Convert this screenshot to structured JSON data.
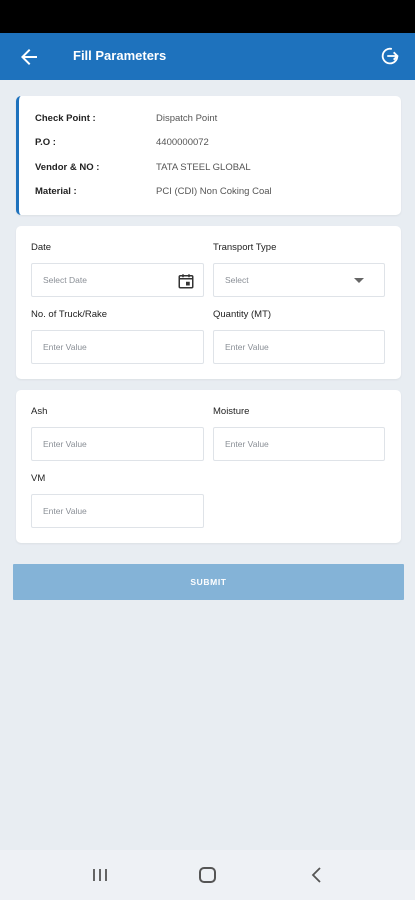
{
  "header": {
    "title": "Fill Parameters",
    "back_icon": "arrow-left-icon",
    "logout_icon": "logout-icon",
    "color": "#1e72bd"
  },
  "info": {
    "rows": [
      {
        "key": "Check Point :",
        "value": "Dispatch Point"
      },
      {
        "key": "P.O :",
        "value": "4400000072"
      },
      {
        "key": "Vendor & NO :",
        "value": "TATA STEEL GLOBAL"
      },
      {
        "key": "Material :",
        "value": "PCI (CDI) Non Coking Coal"
      }
    ]
  },
  "form": {
    "date": {
      "label": "Date",
      "placeholder": "Select Date",
      "icon": "calendar-icon"
    },
    "transport_type": {
      "label": "Transport Type",
      "selected": "Select"
    },
    "trucks": {
      "label": "No. of Truck/Rake",
      "placeholder": "Enter Value"
    },
    "quantity": {
      "label": "Quantity (MT)",
      "placeholder": "Enter Value"
    },
    "ash": {
      "label": "Ash",
      "placeholder": "Enter Value"
    },
    "moisture": {
      "label": "Moisture",
      "placeholder": "Enter Value"
    },
    "vm": {
      "label": "VM",
      "placeholder": "Enter Value"
    }
  },
  "submit": {
    "label": "SUBMIT",
    "color": "#84b3d7"
  },
  "nav": {
    "recents_icon": "recents-icon",
    "home_icon": "home-icon",
    "back_icon": "chevron-left-icon"
  }
}
